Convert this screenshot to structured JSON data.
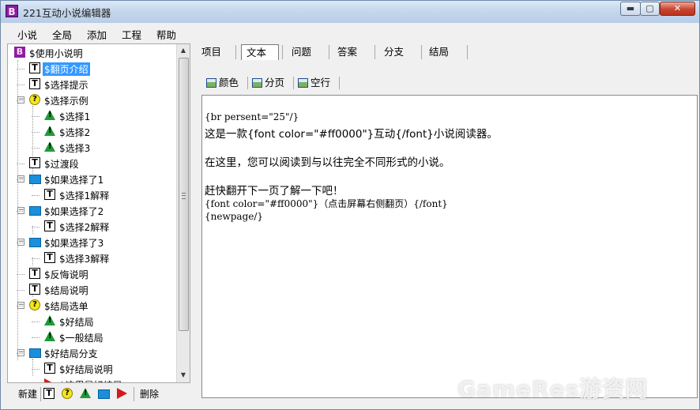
{
  "window": {
    "title": "221互动小说编辑器",
    "app_icon_letter": "B",
    "min_glyph": "▬",
    "max_glyph": "▢",
    "close_glyph": "✕"
  },
  "menu": [
    "小说",
    "全局",
    "添加",
    "工程",
    "帮助"
  ],
  "tree": {
    "items": [
      {
        "label": "$使用小说明",
        "icon": "book-icon",
        "selected": false
      },
      {
        "label": "$翻页介绍",
        "icon": "text-icon",
        "selected": true
      },
      {
        "label": "$选择提示",
        "icon": "text-icon",
        "selected": false
      },
      {
        "label": "$选择示例",
        "icon": "question-icon",
        "selected": false,
        "expander": "−"
      },
      {
        "label": "$选择1",
        "icon": "warning-icon",
        "selected": false
      },
      {
        "label": "$选择2",
        "icon": "warning-icon",
        "selected": false
      },
      {
        "label": "$选择3",
        "icon": "warning-icon",
        "selected": false
      },
      {
        "label": "$过渡段",
        "icon": "text-icon",
        "selected": false
      },
      {
        "label": "$如果选择了1",
        "icon": "folder-icon",
        "selected": false,
        "expander": "−"
      },
      {
        "label": "$选择1解释",
        "icon": "text-icon",
        "selected": false
      },
      {
        "label": "$如果选择了2",
        "icon": "folder-icon",
        "selected": false,
        "expander": "−"
      },
      {
        "label": "$选择2解释",
        "icon": "text-icon",
        "selected": false
      },
      {
        "label": "$如果选择了3",
        "icon": "folder-icon",
        "selected": false,
        "expander": "−"
      },
      {
        "label": "$选择3解释",
        "icon": "text-icon",
        "selected": false
      },
      {
        "label": "$反悔说明",
        "icon": "text-icon",
        "selected": false
      },
      {
        "label": "$结局说明",
        "icon": "text-icon",
        "selected": false
      },
      {
        "label": "$结局选单",
        "icon": "question-icon",
        "selected": false,
        "expander": "−"
      },
      {
        "label": "$好结局",
        "icon": "warning-icon",
        "selected": false
      },
      {
        "label": "$一般结局",
        "icon": "warning-icon",
        "selected": false
      },
      {
        "label": "$好结局分支",
        "icon": "folder-icon",
        "selected": false,
        "expander": "−"
      },
      {
        "label": "$好结局说明",
        "icon": "text-icon",
        "selected": false
      },
      {
        "label": "$这里是好结局",
        "icon": "flag-icon",
        "selected": false
      }
    ]
  },
  "bottom_toolbar": {
    "new_label": "新建",
    "delete_label": "删除",
    "text_glyph": "T",
    "question_glyph": "?"
  },
  "tabs": [
    "项目",
    "文本",
    "问题",
    "答案",
    "分支",
    "结局"
  ],
  "active_tab": "文本",
  "format_toolbar": [
    "颜色",
    "分页",
    "空行"
  ],
  "editor": {
    "lines": [
      "{br persent=\"25\"/}",
      "这是一款{font color=\"#ff0000\"}互动{/font}小说阅读器。",
      "在这里，您可以阅读到与以往完全不同形式的小说。",
      "赶快翻开下一页了解一下吧！",
      "{font color=\"#ff0000\"}（点击屏幕右侧翻页）{/font}",
      "{newpage/}"
    ]
  },
  "watermark": "GameRes游资网",
  "colors": {
    "selection": "#3399ff",
    "folder": "#1a8fdc",
    "warning": "#1f9a37",
    "question": "#f5e61c",
    "flag": "#d41b1b",
    "app_icon": "#8b1ea0"
  }
}
